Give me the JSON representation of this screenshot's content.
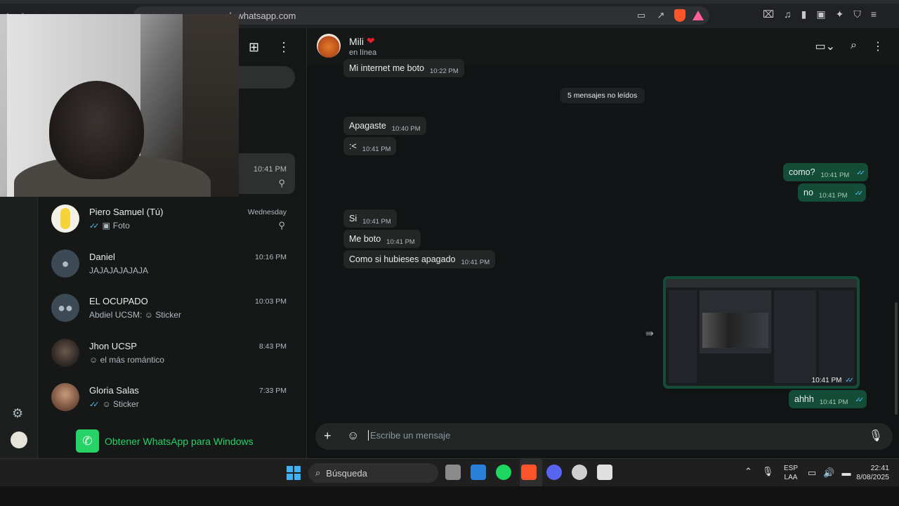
{
  "browser": {
    "url": "web.whatsapp.com"
  },
  "chatlist": {
    "pinned_time": "10:41 PM",
    "chats": [
      {
        "name": "Piero Samuel (Tú)",
        "time": "Wednesday",
        "message": "Foto",
        "ticks": "✓✓",
        "prefix_icon": "photo-icon",
        "pinned": true
      },
      {
        "name": "Daniel",
        "time": "10:16 PM",
        "message": "JAJAJAJAJAJA"
      },
      {
        "name": "EL OCUPADO",
        "time": "10:03 PM",
        "message": "Abdiel UCSM: ☺ Sticker"
      },
      {
        "name": "Jhon UCSP",
        "time": "8:43 PM",
        "message": "☺ el más romántico"
      },
      {
        "name": "Gloria Salas",
        "time": "7:33 PM",
        "message": "☺ Sticker",
        "ticks": "✓✓"
      }
    ],
    "get_app_label": "Obtener WhatsApp para Windows"
  },
  "chat": {
    "contact_name": "Mili",
    "status": "en línea",
    "unread_label": "5 mensajes no leídos",
    "messages": [
      {
        "text": "Mi internet me boto",
        "time": "10:22 PM",
        "dir": "in"
      },
      {
        "text": "Apagaste",
        "time": "10:40 PM",
        "dir": "in"
      },
      {
        "text": ":<",
        "time": "10:41 PM",
        "dir": "in"
      },
      {
        "text": "como?",
        "time": "10:41 PM",
        "dir": "out"
      },
      {
        "text": "no",
        "time": "10:41 PM",
        "dir": "out"
      },
      {
        "text": "Si",
        "time": "10:41 PM",
        "dir": "in"
      },
      {
        "text": "Me boto",
        "time": "10:41 PM",
        "dir": "in"
      },
      {
        "text": "Como si hubieses apagado",
        "time": "10:41 PM",
        "dir": "in"
      },
      {
        "text": "ahhh",
        "time": "10:41 PM",
        "dir": "out"
      }
    ],
    "image_message_time": "10:41 PM",
    "composer_placeholder": "Escribe un mensaje"
  },
  "taskbar": {
    "search_label": "Búsqueda",
    "lang_top": "ESP",
    "lang_bottom": "LAA",
    "time": "22:41",
    "date": "8/08/2025"
  },
  "colors": {
    "outgoing_bubble": "#144d37",
    "incoming_bubble": "#242626",
    "whatsapp_green": "#25d366",
    "read_ticks": "#53bdeb"
  }
}
